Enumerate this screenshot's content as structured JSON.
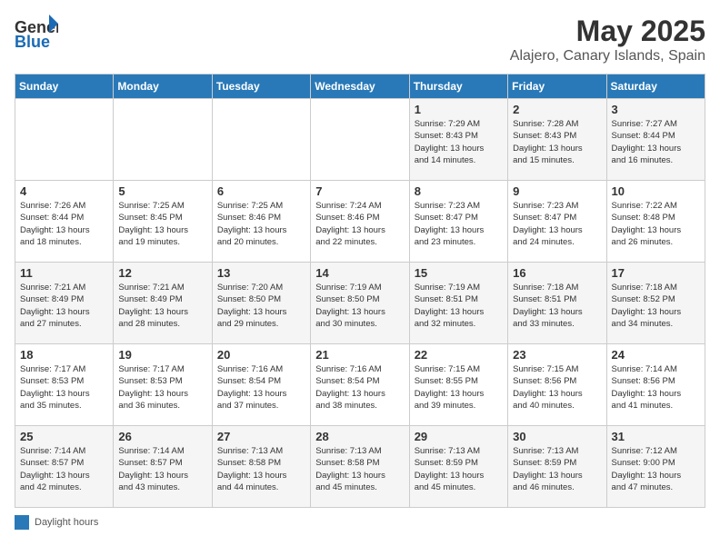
{
  "header": {
    "logo_general": "General",
    "logo_blue": "Blue",
    "month_title": "May 2025",
    "location": "Alajero, Canary Islands, Spain"
  },
  "days_of_week": [
    "Sunday",
    "Monday",
    "Tuesday",
    "Wednesday",
    "Thursday",
    "Friday",
    "Saturday"
  ],
  "weeks": [
    [
      {
        "day": "",
        "info": ""
      },
      {
        "day": "",
        "info": ""
      },
      {
        "day": "",
        "info": ""
      },
      {
        "day": "",
        "info": ""
      },
      {
        "day": "1",
        "info": "Sunrise: 7:29 AM\nSunset: 8:43 PM\nDaylight: 13 hours\nand 14 minutes."
      },
      {
        "day": "2",
        "info": "Sunrise: 7:28 AM\nSunset: 8:43 PM\nDaylight: 13 hours\nand 15 minutes."
      },
      {
        "day": "3",
        "info": "Sunrise: 7:27 AM\nSunset: 8:44 PM\nDaylight: 13 hours\nand 16 minutes."
      }
    ],
    [
      {
        "day": "4",
        "info": "Sunrise: 7:26 AM\nSunset: 8:44 PM\nDaylight: 13 hours\nand 18 minutes."
      },
      {
        "day": "5",
        "info": "Sunrise: 7:25 AM\nSunset: 8:45 PM\nDaylight: 13 hours\nand 19 minutes."
      },
      {
        "day": "6",
        "info": "Sunrise: 7:25 AM\nSunset: 8:46 PM\nDaylight: 13 hours\nand 20 minutes."
      },
      {
        "day": "7",
        "info": "Sunrise: 7:24 AM\nSunset: 8:46 PM\nDaylight: 13 hours\nand 22 minutes."
      },
      {
        "day": "8",
        "info": "Sunrise: 7:23 AM\nSunset: 8:47 PM\nDaylight: 13 hours\nand 23 minutes."
      },
      {
        "day": "9",
        "info": "Sunrise: 7:23 AM\nSunset: 8:47 PM\nDaylight: 13 hours\nand 24 minutes."
      },
      {
        "day": "10",
        "info": "Sunrise: 7:22 AM\nSunset: 8:48 PM\nDaylight: 13 hours\nand 26 minutes."
      }
    ],
    [
      {
        "day": "11",
        "info": "Sunrise: 7:21 AM\nSunset: 8:49 PM\nDaylight: 13 hours\nand 27 minutes."
      },
      {
        "day": "12",
        "info": "Sunrise: 7:21 AM\nSunset: 8:49 PM\nDaylight: 13 hours\nand 28 minutes."
      },
      {
        "day": "13",
        "info": "Sunrise: 7:20 AM\nSunset: 8:50 PM\nDaylight: 13 hours\nand 29 minutes."
      },
      {
        "day": "14",
        "info": "Sunrise: 7:19 AM\nSunset: 8:50 PM\nDaylight: 13 hours\nand 30 minutes."
      },
      {
        "day": "15",
        "info": "Sunrise: 7:19 AM\nSunset: 8:51 PM\nDaylight: 13 hours\nand 32 minutes."
      },
      {
        "day": "16",
        "info": "Sunrise: 7:18 AM\nSunset: 8:51 PM\nDaylight: 13 hours\nand 33 minutes."
      },
      {
        "day": "17",
        "info": "Sunrise: 7:18 AM\nSunset: 8:52 PM\nDaylight: 13 hours\nand 34 minutes."
      }
    ],
    [
      {
        "day": "18",
        "info": "Sunrise: 7:17 AM\nSunset: 8:53 PM\nDaylight: 13 hours\nand 35 minutes."
      },
      {
        "day": "19",
        "info": "Sunrise: 7:17 AM\nSunset: 8:53 PM\nDaylight: 13 hours\nand 36 minutes."
      },
      {
        "day": "20",
        "info": "Sunrise: 7:16 AM\nSunset: 8:54 PM\nDaylight: 13 hours\nand 37 minutes."
      },
      {
        "day": "21",
        "info": "Sunrise: 7:16 AM\nSunset: 8:54 PM\nDaylight: 13 hours\nand 38 minutes."
      },
      {
        "day": "22",
        "info": "Sunrise: 7:15 AM\nSunset: 8:55 PM\nDaylight: 13 hours\nand 39 minutes."
      },
      {
        "day": "23",
        "info": "Sunrise: 7:15 AM\nSunset: 8:56 PM\nDaylight: 13 hours\nand 40 minutes."
      },
      {
        "day": "24",
        "info": "Sunrise: 7:14 AM\nSunset: 8:56 PM\nDaylight: 13 hours\nand 41 minutes."
      }
    ],
    [
      {
        "day": "25",
        "info": "Sunrise: 7:14 AM\nSunset: 8:57 PM\nDaylight: 13 hours\nand 42 minutes."
      },
      {
        "day": "26",
        "info": "Sunrise: 7:14 AM\nSunset: 8:57 PM\nDaylight: 13 hours\nand 43 minutes."
      },
      {
        "day": "27",
        "info": "Sunrise: 7:13 AM\nSunset: 8:58 PM\nDaylight: 13 hours\nand 44 minutes."
      },
      {
        "day": "28",
        "info": "Sunrise: 7:13 AM\nSunset: 8:58 PM\nDaylight: 13 hours\nand 45 minutes."
      },
      {
        "day": "29",
        "info": "Sunrise: 7:13 AM\nSunset: 8:59 PM\nDaylight: 13 hours\nand 45 minutes."
      },
      {
        "day": "30",
        "info": "Sunrise: 7:13 AM\nSunset: 8:59 PM\nDaylight: 13 hours\nand 46 minutes."
      },
      {
        "day": "31",
        "info": "Sunrise: 7:12 AM\nSunset: 9:00 PM\nDaylight: 13 hours\nand 47 minutes."
      }
    ]
  ],
  "legend": {
    "box_color": "#2979b8",
    "label": "Daylight hours"
  }
}
